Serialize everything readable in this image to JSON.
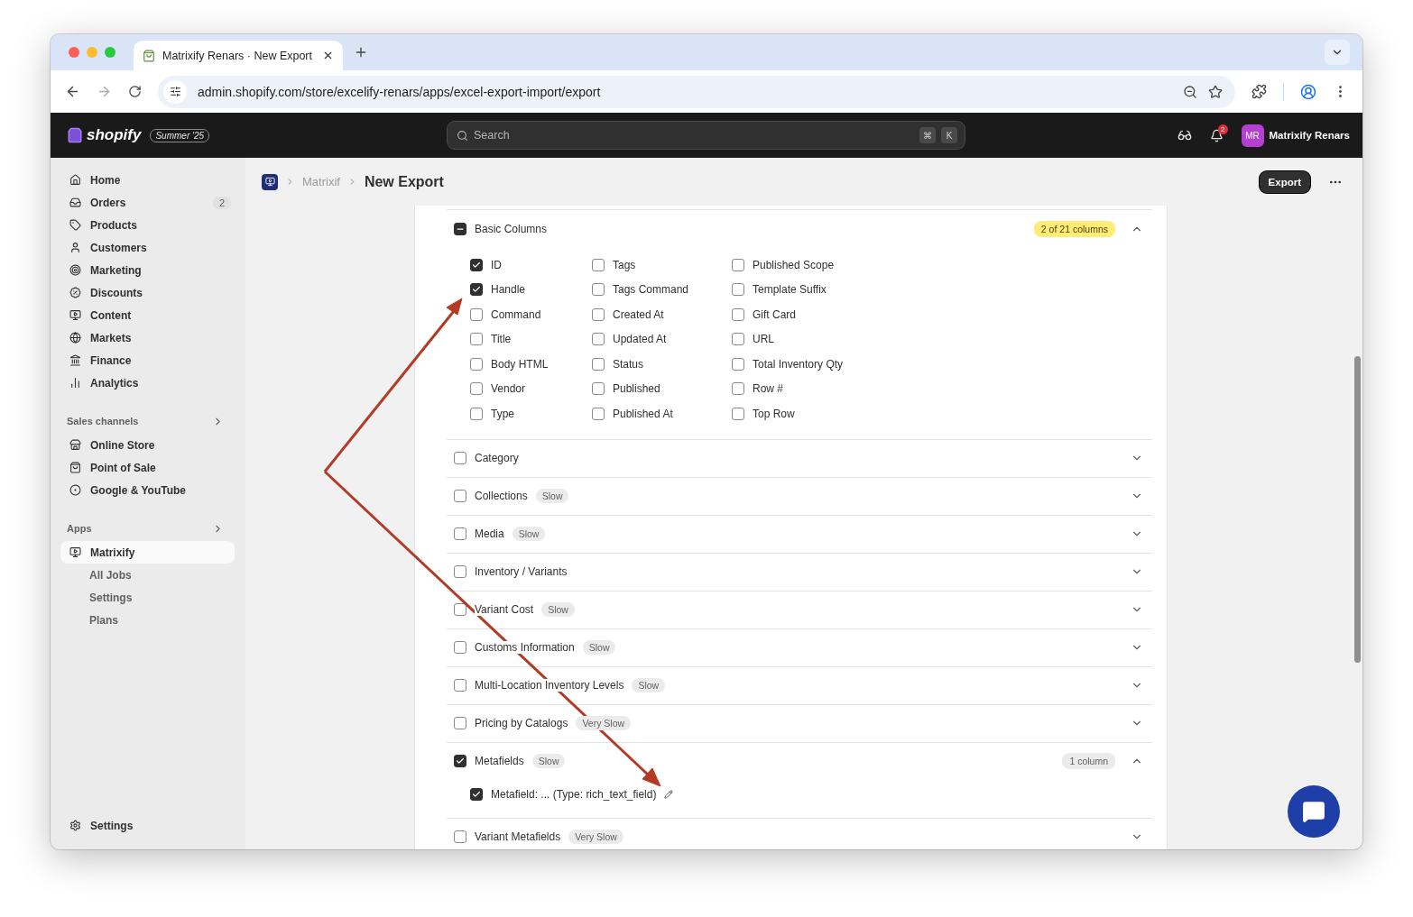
{
  "browser": {
    "tab_title": "Matrixify Renars · New Export",
    "url": "admin.shopify.com/store/excelify-renars/apps/excel-export-import/export"
  },
  "topbar": {
    "logo": "shopify",
    "edition": "Summer '25",
    "search_placeholder": "Search",
    "shortcut_keys": [
      "⌘",
      "K"
    ],
    "notification_count": "2",
    "avatar_initials": "MR",
    "store_name": "Matrixify Renars"
  },
  "sidebar": {
    "items": [
      {
        "label": "Home"
      },
      {
        "label": "Orders",
        "badge": "2"
      },
      {
        "label": "Products"
      },
      {
        "label": "Customers"
      },
      {
        "label": "Marketing"
      },
      {
        "label": "Discounts"
      },
      {
        "label": "Content"
      },
      {
        "label": "Markets"
      },
      {
        "label": "Finance"
      },
      {
        "label": "Analytics"
      }
    ],
    "sections": [
      {
        "title": "Sales channels",
        "items": [
          {
            "label": "Online Store",
            "selected": false
          },
          {
            "label": "Point of Sale",
            "selected": false
          },
          {
            "label": "Google & YouTube",
            "selected": false
          }
        ]
      },
      {
        "title": "Apps",
        "items": [
          {
            "label": "Matrixify",
            "selected": true,
            "children": [
              "All Jobs",
              "Settings",
              "Plans"
            ]
          }
        ]
      }
    ],
    "footer": "Settings"
  },
  "page": {
    "breadcrumb": "Matrixif",
    "title": "New Export",
    "primary_action": "Export"
  },
  "sections": [
    {
      "label": "Basic Columns",
      "checked": true,
      "partial": true,
      "expanded": true,
      "count": {
        "text": "2 of 21 columns",
        "highlighted": true
      },
      "columns": [
        {
          "label": "ID",
          "checked": true
        },
        {
          "label": "Handle",
          "checked": true
        },
        {
          "label": "Command",
          "checked": false
        },
        {
          "label": "Title",
          "checked": false
        },
        {
          "label": "Body HTML",
          "checked": false
        },
        {
          "label": "Vendor",
          "checked": false
        },
        {
          "label": "Type",
          "checked": false
        },
        {
          "label": "Tags",
          "checked": false
        },
        {
          "label": "Tags Command",
          "checked": false
        },
        {
          "label": "Created At",
          "checked": false
        },
        {
          "label": "Updated At",
          "checked": false
        },
        {
          "label": "Status",
          "checked": false
        },
        {
          "label": "Published",
          "checked": false
        },
        {
          "label": "Published At",
          "checked": false
        },
        {
          "label": "Published Scope",
          "checked": false
        },
        {
          "label": "Template Suffix",
          "checked": false
        },
        {
          "label": "Gift Card",
          "checked": false
        },
        {
          "label": "URL",
          "checked": false
        },
        {
          "label": "Total Inventory Qty",
          "checked": false
        },
        {
          "label": "Row #",
          "checked": false
        },
        {
          "label": "Top Row",
          "checked": false
        }
      ]
    },
    {
      "label": "Category",
      "checked": false,
      "expanded": false
    },
    {
      "label": "Collections",
      "checked": false,
      "expanded": false,
      "tag": "Slow"
    },
    {
      "label": "Media",
      "checked": false,
      "expanded": false,
      "tag": "Slow"
    },
    {
      "label": "Inventory / Variants",
      "checked": false,
      "expanded": false
    },
    {
      "label": "Variant Cost",
      "checked": false,
      "expanded": false,
      "tag": "Slow"
    },
    {
      "label": "Customs Information",
      "checked": false,
      "expanded": false,
      "tag": "Slow"
    },
    {
      "label": "Multi-Location Inventory Levels",
      "checked": false,
      "expanded": false,
      "tag": "Slow"
    },
    {
      "label": "Pricing by Catalogs",
      "checked": false,
      "expanded": false,
      "tag": "Very Slow"
    },
    {
      "label": "Metafields",
      "checked": true,
      "expanded": true,
      "tag": "Slow",
      "count": {
        "text": "1 column",
        "highlighted": false
      },
      "items": [
        {
          "label": "Metafield: ... (Type: rich_text_field)",
          "checked": true
        }
      ]
    },
    {
      "label": "Variant Metafields",
      "checked": false,
      "expanded": false,
      "tag": "Very Slow"
    }
  ]
}
